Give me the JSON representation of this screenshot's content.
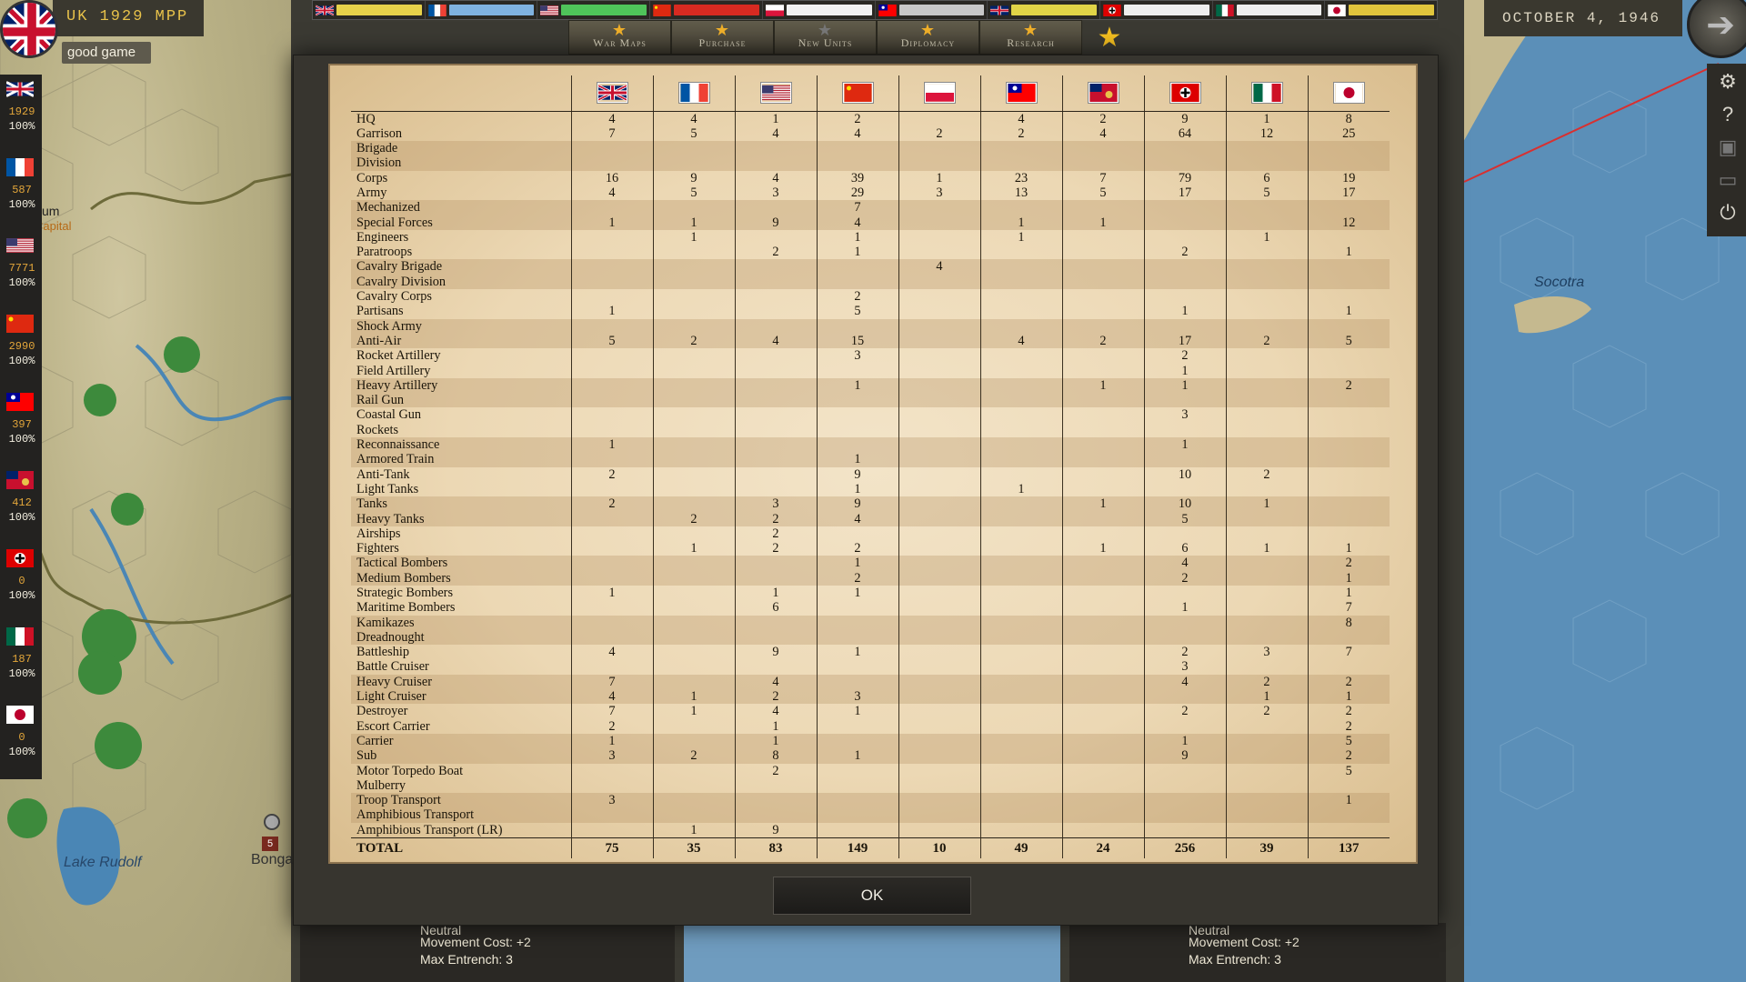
{
  "header": {
    "mpp_label": "UK 1929 MPP",
    "message": "good game",
    "date": "OCTOBER 4, 1946"
  },
  "nav": {
    "buttons": [
      {
        "label": "War Maps",
        "icon": "star-icon"
      },
      {
        "label": "Purchase",
        "icon": "star-icon"
      },
      {
        "label": "New Units",
        "icon": "star-icon"
      },
      {
        "label": "Diplomacy",
        "icon": "star-icon"
      },
      {
        "label": "Research",
        "icon": "star-icon"
      }
    ]
  },
  "nations": [
    {
      "id": "uk",
      "mpp": "1929",
      "readiness": "100%"
    },
    {
      "id": "france",
      "mpp": "587",
      "readiness": "100%"
    },
    {
      "id": "usa",
      "mpp": "7771",
      "readiness": "100%"
    },
    {
      "id": "china",
      "mpp": "2990",
      "readiness": "100%"
    },
    {
      "id": "taiwan",
      "mpp": "397",
      "readiness": "100%"
    },
    {
      "id": "hongkong",
      "mpp": "412",
      "readiness": "100%"
    },
    {
      "id": "nation-cross",
      "mpp": "0",
      "readiness": "100%"
    },
    {
      "id": "nation-mex",
      "mpp": "187",
      "readiness": "100%"
    },
    {
      "id": "japan",
      "mpp": "0",
      "readiness": "100%"
    }
  ],
  "map_labels": {
    "socotra": "Socotra",
    "lake_rudolf": "Lake Rudolf",
    "bonga": "Bonga",
    "fragment_um": "um",
    "fragment_capital": "Capital",
    "unit_badge": "5"
  },
  "bottom_panels": {
    "left": {
      "terrain": "Neutral",
      "movement": "Movement Cost: +2",
      "entrench": "Max Entrench: 3"
    },
    "right": {
      "terrain": "Neutral",
      "movement": "Movement Cost: +2",
      "entrench": "Max Entrench: 3"
    }
  },
  "table": {
    "rows": [
      {
        "name": "HQ",
        "v": [
          "4",
          "4",
          "1",
          "2",
          "",
          "4",
          "2",
          "9",
          "1",
          "8"
        ]
      },
      {
        "name": "Garrison",
        "v": [
          "7",
          "5",
          "4",
          "4",
          "2",
          "2",
          "4",
          "64",
          "12",
          "25"
        ]
      },
      {
        "name": "Brigade",
        "v": [
          "",
          "",
          "",
          "",
          "",
          "",
          "",
          "",
          "",
          ""
        ]
      },
      {
        "name": "Division",
        "v": [
          "",
          "",
          "",
          "",
          "",
          "",
          "",
          "",
          "",
          ""
        ]
      },
      {
        "name": "Corps",
        "v": [
          "16",
          "9",
          "4",
          "39",
          "1",
          "23",
          "7",
          "79",
          "6",
          "19"
        ]
      },
      {
        "name": "Army",
        "v": [
          "4",
          "5",
          "3",
          "29",
          "3",
          "13",
          "5",
          "17",
          "5",
          "17"
        ]
      },
      {
        "name": "Mechanized",
        "v": [
          "",
          "",
          "",
          "7",
          "",
          "",
          "",
          "",
          "",
          ""
        ]
      },
      {
        "name": "Special Forces",
        "v": [
          "1",
          "1",
          "9",
          "4",
          "",
          "1",
          "1",
          "",
          "",
          "12"
        ]
      },
      {
        "name": "Engineers",
        "v": [
          "",
          "1",
          "",
          "1",
          "",
          "1",
          "",
          "",
          "1",
          ""
        ]
      },
      {
        "name": "Paratroops",
        "v": [
          "",
          "",
          "2",
          "1",
          "",
          "",
          "",
          "2",
          "",
          "1"
        ]
      },
      {
        "name": "Cavalry Brigade",
        "v": [
          "",
          "",
          "",
          "",
          "4",
          "",
          "",
          "",
          "",
          ""
        ]
      },
      {
        "name": "Cavalry Division",
        "v": [
          "",
          "",
          "",
          "",
          "",
          "",
          "",
          "",
          "",
          ""
        ]
      },
      {
        "name": "Cavalry Corps",
        "v": [
          "",
          "",
          "",
          "2",
          "",
          "",
          "",
          "",
          "",
          ""
        ]
      },
      {
        "name": "Partisans",
        "v": [
          "1",
          "",
          "",
          "5",
          "",
          "",
          "",
          "1",
          "",
          "1"
        ]
      },
      {
        "name": "Shock Army",
        "v": [
          "",
          "",
          "",
          "",
          "",
          "",
          "",
          "",
          "",
          ""
        ]
      },
      {
        "name": "Anti-Air",
        "v": [
          "5",
          "2",
          "4",
          "15",
          "",
          "4",
          "2",
          "17",
          "2",
          "5"
        ]
      },
      {
        "name": "Rocket Artillery",
        "v": [
          "",
          "",
          "",
          "3",
          "",
          "",
          "",
          "2",
          "",
          ""
        ]
      },
      {
        "name": "Field Artillery",
        "v": [
          "",
          "",
          "",
          "",
          "",
          "",
          "",
          "1",
          "",
          ""
        ]
      },
      {
        "name": "Heavy Artillery",
        "v": [
          "",
          "",
          "",
          "1",
          "",
          "",
          "1",
          "1",
          "",
          "2"
        ]
      },
      {
        "name": "Rail Gun",
        "v": [
          "",
          "",
          "",
          "",
          "",
          "",
          "",
          "",
          "",
          ""
        ]
      },
      {
        "name": "Coastal Gun",
        "v": [
          "",
          "",
          "",
          "",
          "",
          "",
          "",
          "3",
          "",
          ""
        ]
      },
      {
        "name": "Rockets",
        "v": [
          "",
          "",
          "",
          "",
          "",
          "",
          "",
          "",
          "",
          ""
        ]
      },
      {
        "name": "Reconnaissance",
        "v": [
          "1",
          "",
          "",
          "",
          "",
          "",
          "",
          "1",
          "",
          ""
        ]
      },
      {
        "name": "Armored Train",
        "v": [
          "",
          "",
          "",
          "1",
          "",
          "",
          "",
          "",
          "",
          ""
        ]
      },
      {
        "name": "Anti-Tank",
        "v": [
          "2",
          "",
          "",
          "9",
          "",
          "",
          "",
          "10",
          "2",
          ""
        ]
      },
      {
        "name": "Light Tanks",
        "v": [
          "",
          "",
          "",
          "1",
          "",
          "1",
          "",
          "",
          "",
          ""
        ]
      },
      {
        "name": "Tanks",
        "v": [
          "2",
          "",
          "3",
          "9",
          "",
          "",
          "1",
          "10",
          "1",
          ""
        ]
      },
      {
        "name": "Heavy Tanks",
        "v": [
          "",
          "2",
          "2",
          "4",
          "",
          "",
          "",
          "5",
          "",
          ""
        ]
      },
      {
        "name": "Airships",
        "v": [
          "",
          "",
          "2",
          "",
          "",
          "",
          "",
          "",
          "",
          ""
        ]
      },
      {
        "name": "Fighters",
        "v": [
          "",
          "1",
          "2",
          "2",
          "",
          "",
          "1",
          "6",
          "1",
          "1"
        ]
      },
      {
        "name": "Tactical Bombers",
        "v": [
          "",
          "",
          "",
          "1",
          "",
          "",
          "",
          "4",
          "",
          "2"
        ]
      },
      {
        "name": "Medium Bombers",
        "v": [
          "",
          "",
          "",
          "2",
          "",
          "",
          "",
          "2",
          "",
          "1"
        ]
      },
      {
        "name": "Strategic Bombers",
        "v": [
          "1",
          "",
          "1",
          "1",
          "",
          "",
          "",
          "",
          "",
          "1"
        ]
      },
      {
        "name": "Maritime Bombers",
        "v": [
          "",
          "",
          "6",
          "",
          "",
          "",
          "",
          "1",
          "",
          "7"
        ]
      },
      {
        "name": "Kamikazes",
        "v": [
          "",
          "",
          "",
          "",
          "",
          "",
          "",
          "",
          "",
          "8"
        ]
      },
      {
        "name": "Dreadnought",
        "v": [
          "",
          "",
          "",
          "",
          "",
          "",
          "",
          "",
          "",
          ""
        ]
      },
      {
        "name": "Battleship",
        "v": [
          "4",
          "",
          "9",
          "1",
          "",
          "",
          "",
          "2",
          "3",
          "7"
        ]
      },
      {
        "name": "Battle Cruiser",
        "v": [
          "",
          "",
          "",
          "",
          "",
          "",
          "",
          "3",
          "",
          ""
        ]
      },
      {
        "name": "Heavy Cruiser",
        "v": [
          "7",
          "",
          "4",
          "",
          "",
          "",
          "",
          "4",
          "2",
          "2"
        ]
      },
      {
        "name": "Light Cruiser",
        "v": [
          "4",
          "1",
          "2",
          "3",
          "",
          "",
          "",
          "",
          "1",
          "1"
        ]
      },
      {
        "name": "Destroyer",
        "v": [
          "7",
          "1",
          "4",
          "1",
          "",
          "",
          "",
          "2",
          "2",
          "2"
        ]
      },
      {
        "name": "Escort Carrier",
        "v": [
          "2",
          "",
          "1",
          "",
          "",
          "",
          "",
          "",
          "",
          "2"
        ]
      },
      {
        "name": "Carrier",
        "v": [
          "1",
          "",
          "1",
          "",
          "",
          "",
          "",
          "1",
          "",
          "5"
        ]
      },
      {
        "name": "Sub",
        "v": [
          "3",
          "2",
          "8",
          "1",
          "",
          "",
          "",
          "9",
          "",
          "2"
        ]
      },
      {
        "name": "Motor Torpedo Boat",
        "v": [
          "",
          "",
          "2",
          "",
          "",
          "",
          "",
          "",
          "",
          "5"
        ]
      },
      {
        "name": "Mulberry",
        "v": [
          "",
          "",
          "",
          "",
          "",
          "",
          "",
          "",
          "",
          ""
        ]
      },
      {
        "name": "Troop Transport",
        "v": [
          "3",
          "",
          "",
          "",
          "",
          "",
          "",
          "",
          "",
          "1"
        ]
      },
      {
        "name": "Amphibious Transport",
        "v": [
          "",
          "",
          "",
          "",
          "",
          "",
          "",
          "",
          "",
          ""
        ]
      },
      {
        "name": "Amphibious Transport (LR)",
        "v": [
          "",
          "1",
          "9",
          "",
          "",
          "",
          "",
          "",
          "",
          ""
        ]
      }
    ],
    "total_label": "TOTAL",
    "totals": [
      "75",
      "35",
      "83",
      "149",
      "10",
      "49",
      "24",
      "256",
      "39",
      "137"
    ]
  },
  "ok_label": "OK",
  "colors": {
    "mpp_gold": "#e8c24a",
    "parchment": "#ecd8b4",
    "star_active": "#f0b02a"
  }
}
